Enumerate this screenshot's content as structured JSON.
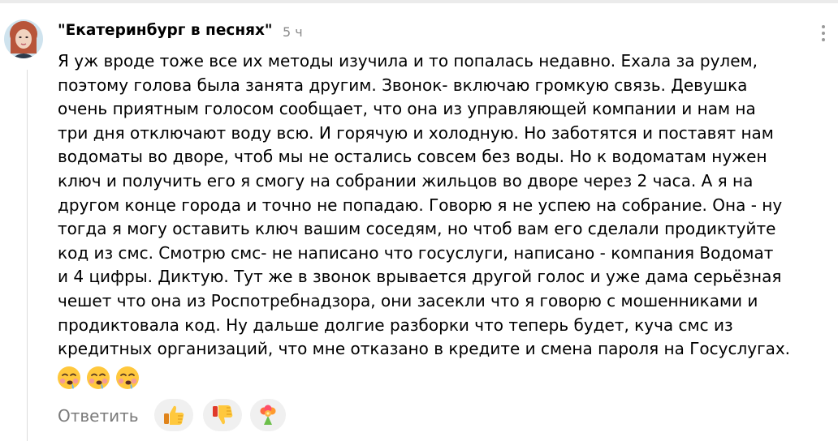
{
  "comment": {
    "author": "\"Екатеринбург в песнях\"",
    "time": "5 ч",
    "text_lines": [
      "Я уж вроде тоже все их методы изучила и то попалась недавно. Ехала за рулем,",
      "поэтому голова была занята другим. Звонок- включаю громкую связь. Девушка",
      "очень приятным голосом сообщает, что она из управляющей компании и нам на",
      "три дня отключают воду всю. И горячую и холодную. Но заботятся и поставят нам",
      "водоматы во дворе, чтоб мы не остались совсем без воды. Но к водоматам нужен",
      "ключ и получить его я смогу на собрании жильцов во дворе через 2 часа. А я на",
      "другом конце города и точно не попадаю. Говорю я не успею на собрание. Она - ну",
      "тогда я могу оставить ключ вашим соседям, но чтоб вам его сделали продиктуйте",
      "код из смс. Смотрю смс- не написано что госуслуги, написано - компания Водомат",
      "и 4 цифры. Диктую. Тут же в звонок врывается другой голос и уже дама серьёзная",
      "чешет что она из Роспотребнадзора, они засекли что я говорю с мошенниками и",
      "продиктовала код. Ну дальше долгие разборки что теперь будет, куча смс из",
      "кредитных организаций, что мне отказано в кредите и смена пароля на Госуслугах."
    ],
    "emojis": [
      "face-with-spiral-eyes-emoji",
      "face-with-spiral-eyes-emoji",
      "face-with-spiral-eyes-emoji"
    ]
  },
  "actions": {
    "reply_label": "Ответить",
    "reactions": [
      "thumbs-up-icon",
      "thumbs-down-icon",
      "flower-bouquet-icon"
    ]
  },
  "colors": {
    "text": "#000000",
    "muted": "#8a8a8a",
    "reaction_bg": "#f0f0f0",
    "emoji_yellow": "#ffc83d"
  }
}
